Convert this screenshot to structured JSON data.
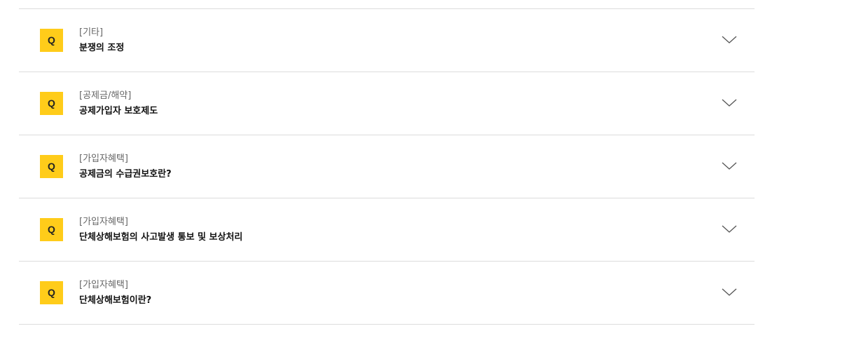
{
  "faq": {
    "items": [
      {
        "badge": "Q",
        "category": "[기타]",
        "question": "분쟁의 조정",
        "icon": "chevron-down-icon"
      },
      {
        "badge": "Q",
        "category": "[공제금/해약]",
        "question": "공제가입자 보호제도",
        "icon": "chevron-down-icon"
      },
      {
        "badge": "Q",
        "category": "[가입자혜택]",
        "question": "공제금의 수급권보호란?",
        "icon": "chevron-down-icon"
      },
      {
        "badge": "Q",
        "category": "[가입자혜택]",
        "question": "단체상해보험의 사고발생 통보 및 보상처리",
        "icon": "chevron-down-icon"
      },
      {
        "badge": "Q",
        "category": "[가입자혜택]",
        "question": "단체상해보험이란?",
        "icon": "chevron-down-icon"
      }
    ]
  },
  "colors": {
    "badge_background": "#ffcc1a",
    "divider": "#dcdcdc",
    "category_text": "#666666",
    "question_text": "#111111"
  }
}
